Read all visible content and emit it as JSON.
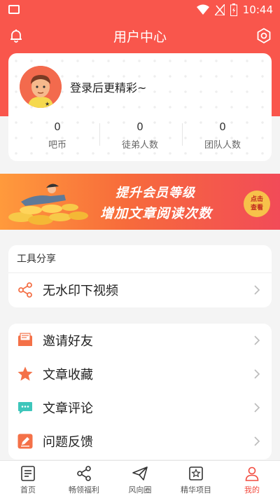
{
  "status_bar": {
    "time": "10:44"
  },
  "app_bar": {
    "title": "用户中心"
  },
  "profile": {
    "login_prompt": "登录后更精彩~",
    "stats": [
      {
        "value": "0",
        "label": "吧币"
      },
      {
        "value": "0",
        "label": "徒弟人数"
      },
      {
        "value": "0",
        "label": "团队人数"
      }
    ]
  },
  "banner": {
    "line1": "提升会员等级",
    "line2": "增加文章阅读次数",
    "cta_line1": "点击",
    "cta_line2": "查看"
  },
  "tools": {
    "header": "工具分享",
    "items": [
      {
        "label": "无水印下视频",
        "icon": "share-icon"
      }
    ]
  },
  "menu": {
    "items": [
      {
        "label": "邀请好友",
        "icon": "invite-icon"
      },
      {
        "label": "文章收藏",
        "icon": "star-icon"
      },
      {
        "label": "文章评论",
        "icon": "comment-icon"
      },
      {
        "label": "问题反馈",
        "icon": "edit-icon"
      }
    ]
  },
  "bottom_nav": {
    "items": [
      {
        "label": "首页"
      },
      {
        "label": "畅领福利"
      },
      {
        "label": "风向圈"
      },
      {
        "label": "精华项目"
      },
      {
        "label": "我的"
      }
    ],
    "active": "我的"
  },
  "colors": {
    "brand": "#f9564c",
    "accent_orange": "#f47148"
  }
}
